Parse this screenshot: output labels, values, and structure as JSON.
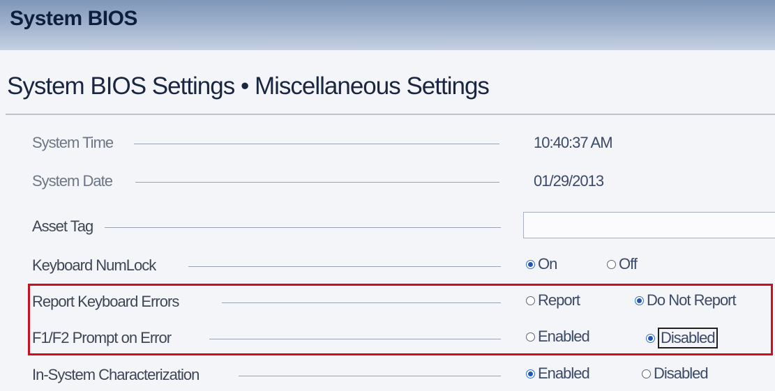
{
  "header": {
    "title": "System BIOS"
  },
  "page": {
    "title": "System BIOS Settings • Miscellaneous Settings"
  },
  "rows": {
    "system_time": {
      "label": "System Time",
      "value": "10:40:37 AM"
    },
    "system_date": {
      "label": "System Date",
      "value": "01/29/2013"
    },
    "asset_tag": {
      "label": "Asset Tag",
      "value": ""
    },
    "numlock": {
      "label": "Keyboard NumLock",
      "opt1": "On",
      "opt2": "Off",
      "selected": "On"
    },
    "report_kb_errors": {
      "label": "Report Keyboard Errors",
      "opt1": "Report",
      "opt2": "Do Not Report",
      "selected": "Do Not Report"
    },
    "f1f2_prompt": {
      "label": "F1/F2 Prompt on Error",
      "opt1": "Enabled",
      "opt2": "Disabled",
      "selected": "Disabled"
    },
    "in_system_char": {
      "label": "In-System Characterization",
      "opt1": "Enabled",
      "opt2": "Disabled",
      "selected": "Enabled"
    }
  },
  "colors": {
    "highlight_border": "#c8101f",
    "header_accent": "#7f97b8",
    "radio_selected": "#1e58b0"
  }
}
